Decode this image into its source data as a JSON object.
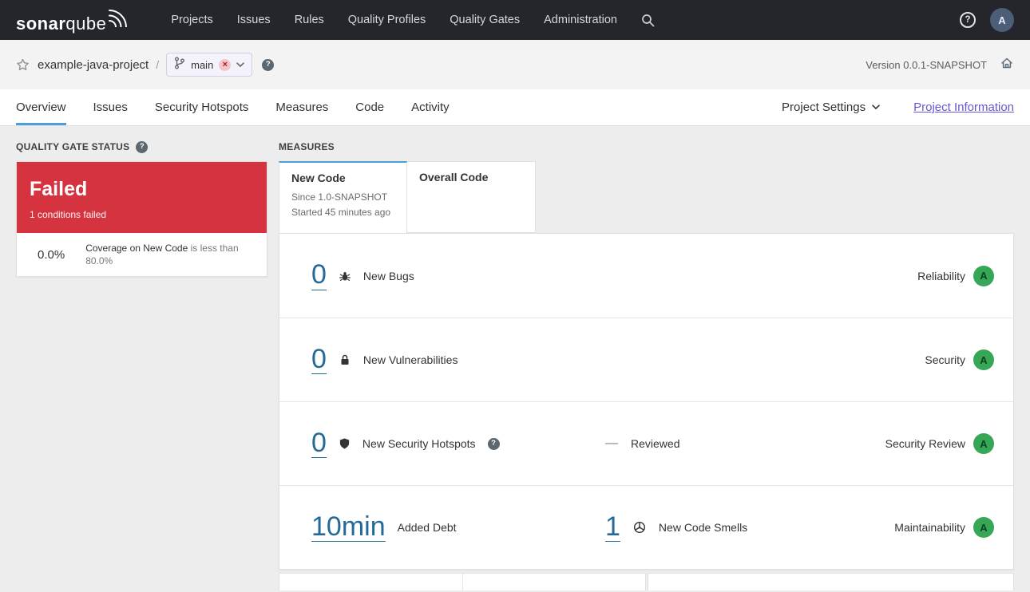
{
  "navbar": {
    "logo": {
      "primary": "sonar",
      "secondary": "qube"
    },
    "items": [
      {
        "label": "Projects"
      },
      {
        "label": "Issues"
      },
      {
        "label": "Rules"
      },
      {
        "label": "Quality Profiles"
      },
      {
        "label": "Quality Gates"
      },
      {
        "label": "Administration"
      }
    ],
    "help_label": "?",
    "avatar_initial": "A"
  },
  "breadcrumb": {
    "project": "example-java-project",
    "separator": "/",
    "branch": {
      "name": "main",
      "badge": "×"
    },
    "help_label": "?",
    "version": "Version 0.0.1-SNAPSHOT"
  },
  "tabs": {
    "items": [
      {
        "label": "Overview"
      },
      {
        "label": "Issues"
      },
      {
        "label": "Security Hotspots"
      },
      {
        "label": "Measures"
      },
      {
        "label": "Code"
      },
      {
        "label": "Activity"
      }
    ],
    "project_settings": "Project Settings",
    "project_information": "Project Information"
  },
  "quality_gate": {
    "heading": "QUALITY GATE STATUS",
    "help_label": "?",
    "status": "Failed",
    "conditions_summary": "1 conditions failed",
    "condition": {
      "value": "0.0%",
      "metric": "Coverage on New Code",
      "requirement": "is less than 80.0%"
    }
  },
  "measures": {
    "heading": "MEASURES",
    "new_code_tab": {
      "label": "New Code",
      "since": "Since 1.0-SNAPSHOT",
      "started": "Started 45 minutes ago"
    },
    "overall_code_tab": {
      "label": "Overall Code"
    },
    "rows": [
      {
        "value": "0",
        "label": "New Bugs",
        "category": "Reliability",
        "rating": "A"
      },
      {
        "value": "0",
        "label": "New Vulnerabilities",
        "category": "Security",
        "rating": "A"
      },
      {
        "value": "0",
        "label": "New Security Hotspots",
        "help_label": "?",
        "reviewed_value": "—",
        "reviewed_label": "Reviewed",
        "category": "Security Review",
        "rating": "A"
      },
      {
        "value": "10min",
        "label": "Added Debt",
        "secondary_value": "1",
        "secondary_label": "New Code Smells",
        "category": "Maintainability",
        "rating": "A"
      }
    ]
  },
  "colors": {
    "navbar_bg": "#24262b",
    "failed_red": "#d4333f",
    "rating_a_green": "#36a657",
    "link_blue": "#236a97",
    "active_tab_blue": "#4b9fd5",
    "project_info_link": "#6658d8"
  }
}
